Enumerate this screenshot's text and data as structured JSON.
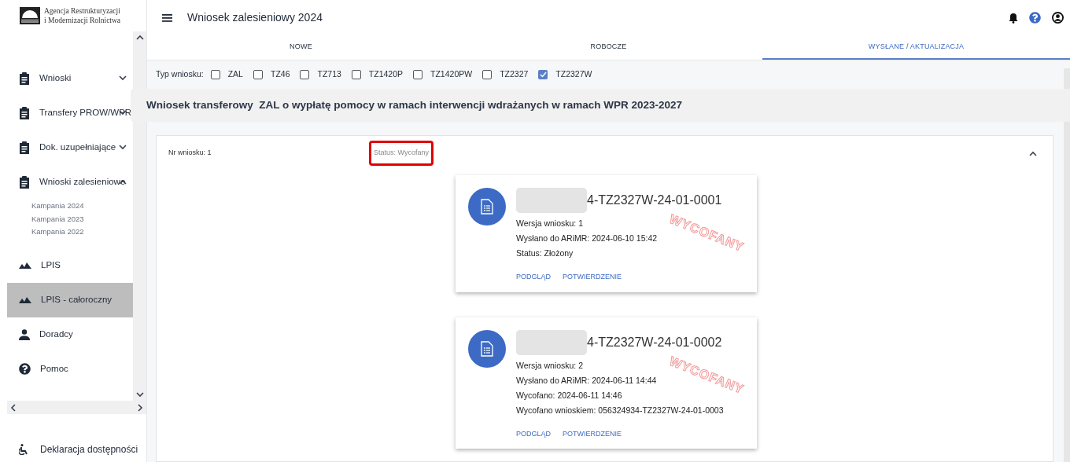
{
  "logo": {
    "line1": "Agencja Restrukturyzacji",
    "line2": "i Modernizacji Rolnictwa"
  },
  "sidebar": {
    "items": [
      {
        "label": "Wnioski",
        "kind": "clipboard",
        "expanded": false,
        "selected": false
      },
      {
        "label": "Transfery PROW/WPR",
        "kind": "clipboard",
        "expanded": false,
        "selected": false
      },
      {
        "label": "Dok. uzupełniające",
        "kind": "clipboard",
        "expanded": false,
        "selected": false
      },
      {
        "label": "Wnioski zalesieniowe",
        "kind": "clipboard",
        "expanded": true,
        "selected": false,
        "children": [
          {
            "label": "Kampania 2024"
          },
          {
            "label": "Kampania 2023"
          },
          {
            "label": "Kampania 2022"
          }
        ]
      },
      {
        "label": "LPIS",
        "kind": "terrain",
        "selected": false
      },
      {
        "label": "LPIS - całoroczny",
        "kind": "terrain",
        "selected": true
      },
      {
        "label": "Doradcy",
        "kind": "person",
        "selected": false
      },
      {
        "label": "Pomoc",
        "kind": "help",
        "selected": false
      }
    ],
    "footer": {
      "label": "Deklaracja dostępności"
    }
  },
  "header": {
    "title": "Wniosek zalesieniowy 2024"
  },
  "tabs": [
    {
      "label": "NOWE",
      "selected": false
    },
    {
      "label": "ROBOCZE",
      "selected": false
    },
    {
      "label": "WYSŁANE / AKTUALIZACJA",
      "selected": true
    }
  ],
  "filter": {
    "label": "Typ wniosku:",
    "options": [
      {
        "label": "ZAL",
        "checked": false
      },
      {
        "label": "TZ46",
        "checked": false
      },
      {
        "label": "TZ713",
        "checked": false
      },
      {
        "label": "TZ1420P",
        "checked": false
      },
      {
        "label": "TZ1420PW",
        "checked": false
      },
      {
        "label": "TZ2327",
        "checked": false
      },
      {
        "label": "TZ2327W",
        "checked": true
      }
    ]
  },
  "banner": {
    "title": "Wniosek transferowy  ZAL o wypłatę pomocy w ramach interwencji wdrażanych w ramach WPR 2023-2027"
  },
  "panel": {
    "number": "Nr wniosku: 1",
    "status": "Status: Wycofany",
    "status_highlighted": true,
    "expanded": true,
    "cards": [
      {
        "id_suffix": "4-TZ2327W-24-01-0001",
        "redacted": true,
        "stamp": "WYCOFANY",
        "lines": [
          "Wersja wniosku: 1",
          "Wysłano do ARiMR: 2024-06-10 15:42",
          "Status: Złożony"
        ],
        "actions": [
          "PODGLĄD",
          "POTWIERDZENIE"
        ]
      },
      {
        "id_suffix": "4-TZ2327W-24-01-0002",
        "redacted": true,
        "stamp": "WYCOFANY",
        "lines": [
          "Wersja wniosku: 2",
          "Wysłano do ARiMR: 2024-06-11 14:44",
          "Wycofano: 2024-06-11 14:46",
          "Wycofano wnioskiem: 056324934-TZ2327W-24-01-0003"
        ],
        "actions": [
          "PODGLĄD",
          "POTWIERDZENIE"
        ]
      }
    ]
  }
}
